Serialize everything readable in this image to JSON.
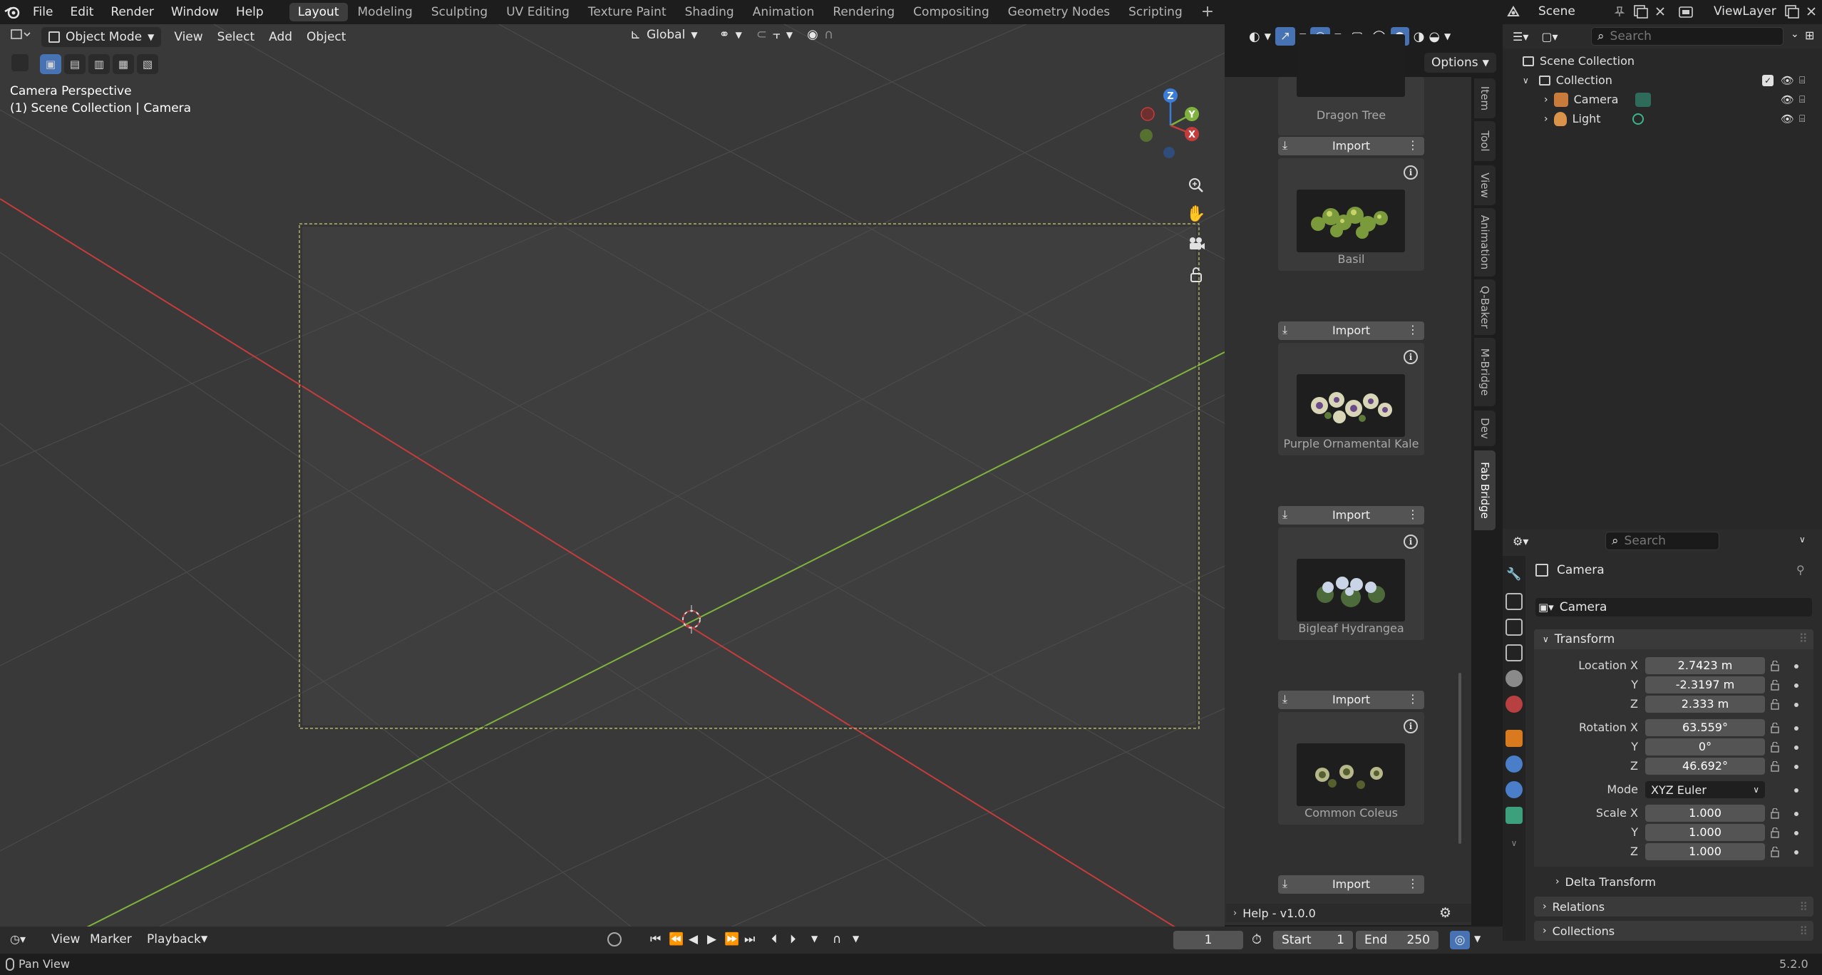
{
  "app": {
    "menus": [
      "File",
      "Edit",
      "Render",
      "Window",
      "Help"
    ],
    "workspaces": [
      "Layout",
      "Modeling",
      "Sculpting",
      "UV Editing",
      "Texture Paint",
      "Shading",
      "Animation",
      "Rendering",
      "Compositing",
      "Geometry Nodes",
      "Scripting"
    ],
    "active_workspace": "Layout",
    "add_workspace": "+",
    "scene_name": "Scene",
    "view_layer": "ViewLayer",
    "version": "5.2.0"
  },
  "viewport": {
    "mode": "Object Mode",
    "menus": [
      "View",
      "Select",
      "Add",
      "Object"
    ],
    "transform_orientation": "Global",
    "options_label": "Options",
    "overlay_title": "Camera Perspective",
    "overlay_context": "(1) Scene Collection | Camera",
    "gizmo_labels": {
      "z": "Z",
      "y": "Y",
      "x": "X"
    },
    "colors": {
      "x_axis": "#c43c3c",
      "y_axis": "#7fb33d",
      "z_axis": "#3b7dd8",
      "bg": "#393939"
    }
  },
  "side_tabs": [
    "Item",
    "Tool",
    "View",
    "Animation",
    "Q-Baker",
    "M-Bridge",
    "Dev",
    "Fab Bridge"
  ],
  "active_side_tab": "Fab Bridge",
  "fab_bridge": {
    "assets": [
      {
        "name": "Dragon Tree",
        "import_label": "Import"
      },
      {
        "name": "Basil",
        "import_label": "Import"
      },
      {
        "name": "Purple Ornamental Kale",
        "import_label": "Import"
      },
      {
        "name": "Bigleaf Hydrangea",
        "import_label": "Import"
      },
      {
        "name": "Common Coleus",
        "import_label": "Import"
      }
    ],
    "help_label": "Help - v1.0.0"
  },
  "outliner": {
    "search_placeholder": "Search",
    "root": "Scene Collection",
    "collection": "Collection",
    "items": [
      "Camera",
      "Light"
    ]
  },
  "properties": {
    "search_placeholder": "Search",
    "object_name": "Camera",
    "datablock_name": "Camera",
    "transform_header": "Transform",
    "location_label": "Location X",
    "rotation_label": "Rotation X",
    "scale_label": "Scale X",
    "axis_y": "Y",
    "axis_z": "Z",
    "location": [
      "2.7423 m",
      "-2.3197 m",
      "2.333 m"
    ],
    "rotation": [
      "63.559°",
      "0°",
      "46.692°"
    ],
    "mode_label": "Mode",
    "mode_value": "XYZ Euler",
    "scale": [
      "1.000",
      "1.000",
      "1.000"
    ],
    "sections": [
      "Delta Transform",
      "Relations",
      "Collections"
    ]
  },
  "timeline": {
    "menus": [
      "View",
      "Marker",
      "Playback"
    ],
    "current_frame": "1",
    "start_label": "Start",
    "start": "1",
    "end_label": "End",
    "end": "250"
  },
  "status": {
    "hint": "Pan View"
  }
}
